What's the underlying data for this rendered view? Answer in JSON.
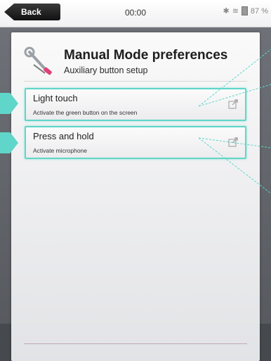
{
  "topbar": {
    "back_label": "Back",
    "clock": "00:00",
    "battery": "87 %"
  },
  "dialog": {
    "title": "Manual Mode preferences",
    "subtitle": "Auxiliary button setup",
    "header_icon": "wrench-screwdriver-icon",
    "items": [
      {
        "title": "Light touch",
        "description": "Activate the green button on the screen",
        "icon": "external-link-icon"
      },
      {
        "title": "Press and hold",
        "description": "Activate microphone",
        "icon": "external-link-icon"
      }
    ]
  },
  "colors": {
    "highlight": "#5fd6c9",
    "back_button": "#1a1a1a"
  }
}
